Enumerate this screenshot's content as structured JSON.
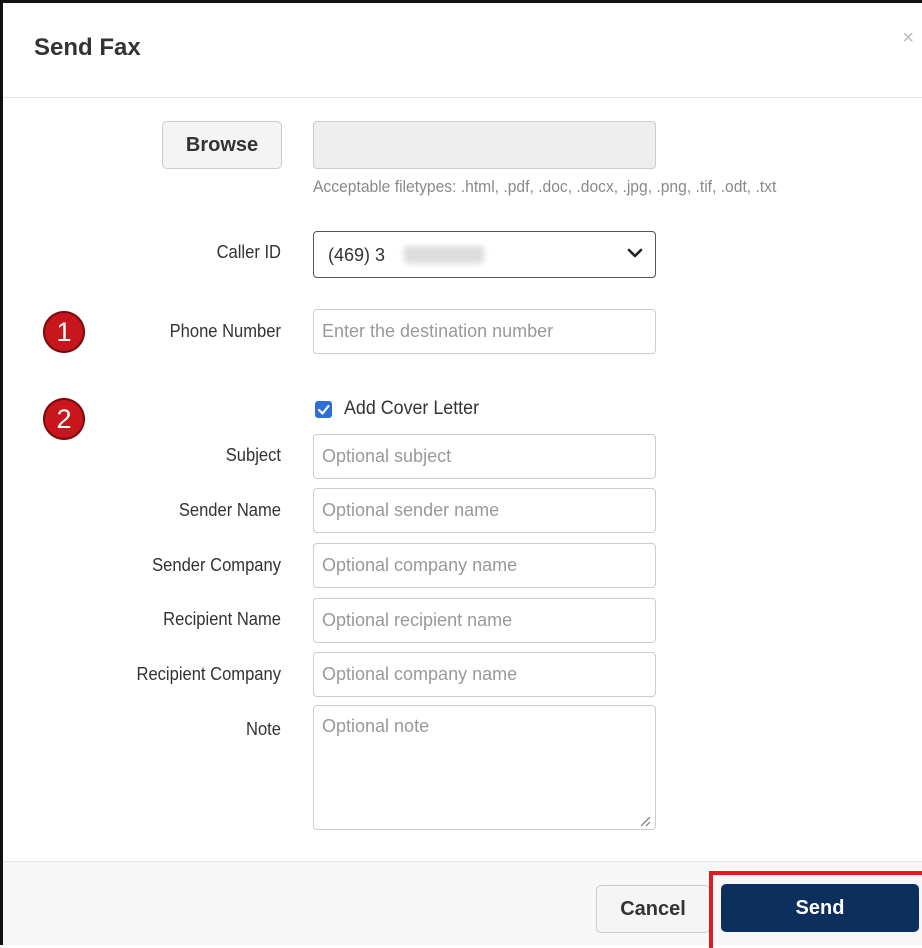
{
  "dialog": {
    "title": "Send Fax",
    "close_symbol": "×"
  },
  "file": {
    "browse_label": "Browse",
    "hint": "Acceptable filetypes: .html, .pdf, .doc, .docx, .jpg, .png, .tif, .odt, .txt"
  },
  "caller_id": {
    "label": "Caller ID",
    "value": "(469) 3"
  },
  "phone": {
    "label": "Phone Number",
    "placeholder": "Enter the destination number"
  },
  "cover_letter": {
    "label": "Add Cover Letter",
    "checked": true
  },
  "fields": {
    "subject": {
      "label": "Subject",
      "placeholder": "Optional subject"
    },
    "sender_name": {
      "label": "Sender Name",
      "placeholder": "Optional sender name"
    },
    "sender_company": {
      "label": "Sender Company",
      "placeholder": "Optional company name"
    },
    "recipient_name": {
      "label": "Recipient Name",
      "placeholder": "Optional recipient name"
    },
    "recipient_company": {
      "label": "Recipient Company",
      "placeholder": "Optional company name"
    },
    "note": {
      "label": "Note",
      "placeholder": "Optional note"
    }
  },
  "annotations": {
    "badge_1": "1",
    "badge_2": "2"
  },
  "footer": {
    "cancel_label": "Cancel",
    "send_label": "Send"
  },
  "colors": {
    "send_button": "#0c2f5e",
    "badge": "#c8161d",
    "highlight": "#e11b22",
    "checkbox": "#2d6fd6"
  }
}
